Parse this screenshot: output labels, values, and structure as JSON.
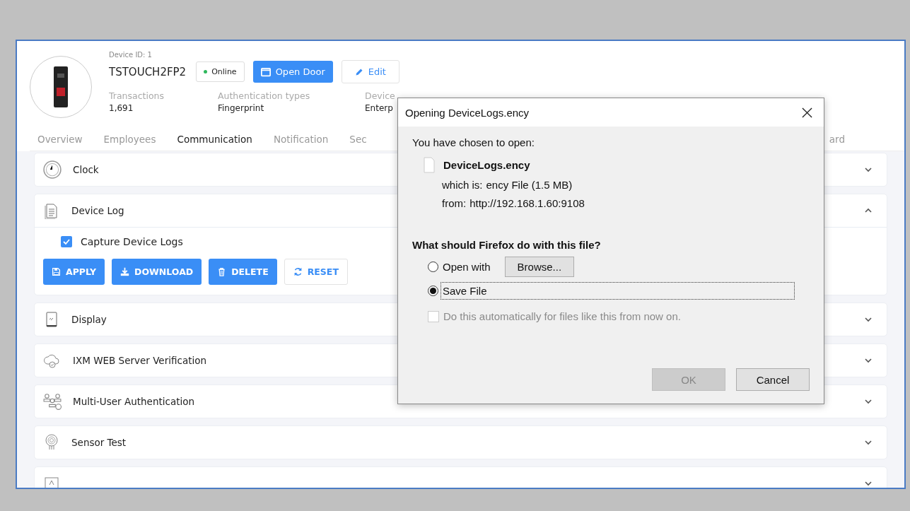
{
  "device": {
    "id_label": "Device ID: 1",
    "name": "TSTOUCH2FP2",
    "status": {
      "label": "Online",
      "color": "#2eb85c"
    },
    "open_door": "Open Door",
    "edit": "Edit",
    "stats": [
      {
        "label": "Transactions",
        "value": "1,691"
      },
      {
        "label": "Authentication types",
        "value": "Fingerprint"
      },
      {
        "label": "Device",
        "value": "Enterp"
      }
    ]
  },
  "tabs": [
    {
      "label": "Overview",
      "selected": false
    },
    {
      "label": "Employees",
      "selected": false
    },
    {
      "label": "Communication",
      "selected": true
    },
    {
      "label": "Notification",
      "selected": false
    },
    {
      "label": "Sec",
      "selected": false
    },
    {
      "label": "ard",
      "selected": false
    }
  ],
  "sections": [
    {
      "title": "Clock",
      "kind": "clock",
      "expanded": false
    },
    {
      "title": "Device Log",
      "kind": "log",
      "expanded": true,
      "option": {
        "label": "Capture Device Logs",
        "checked": true
      },
      "buttons": [
        {
          "label": "APPLY",
          "kind": "primary"
        },
        {
          "label": "DOWNLOAD",
          "kind": "primary"
        },
        {
          "label": "DELETE",
          "kind": "primary"
        },
        {
          "label": "RESET",
          "kind": "outline"
        }
      ]
    },
    {
      "title": "Display",
      "kind": "display",
      "expanded": false
    },
    {
      "title": "IXM WEB Server Verification",
      "kind": "cloud",
      "expanded": false
    },
    {
      "title": "Multi-User Authentication",
      "kind": "users",
      "expanded": false
    },
    {
      "title": "Sensor Test",
      "kind": "sensor",
      "expanded": false
    },
    {
      "kind": "template",
      "expanded": false
    }
  ],
  "dialog": {
    "title": "Opening DeviceLogs.ency",
    "intro": "You have chosen to open:",
    "file_name": "DeviceLogs.ency",
    "which_label": "which is:",
    "which_value": "ency File (1.5 MB)",
    "from_label": "from:",
    "from_value": "http://192.168.1.60:9108",
    "question": "What should Firefox do with this file?",
    "options": [
      {
        "label": "Open with",
        "selected": false,
        "browse": "Browse..."
      },
      {
        "label": "Save File",
        "selected": true
      }
    ],
    "auto": {
      "label": "Do this automatically for files like this from now on.",
      "checked": false,
      "disabled": true
    },
    "buttons": [
      {
        "label": "OK",
        "disabled": true
      },
      {
        "label": "Cancel",
        "disabled": false
      }
    ]
  }
}
